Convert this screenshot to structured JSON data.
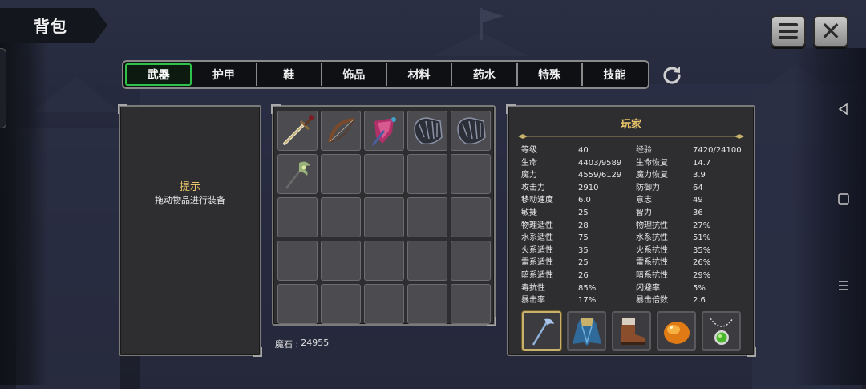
{
  "screen": {
    "title": "背包"
  },
  "top_buttons": {
    "menu_icon": "hamburger-menu-icon",
    "close_icon": "close-x-icon",
    "close_glyph": "✕"
  },
  "tabs": [
    {
      "label": "武器",
      "active": true
    },
    {
      "label": "护甲",
      "active": false
    },
    {
      "label": "鞋",
      "active": false
    },
    {
      "label": "饰品",
      "active": false
    },
    {
      "label": "材料",
      "active": false
    },
    {
      "label": "药水",
      "active": false
    },
    {
      "label": "特殊",
      "active": false
    },
    {
      "label": "技能",
      "active": false
    }
  ],
  "hint": {
    "title": "提示",
    "text": "拖动物品进行装备"
  },
  "inventory": {
    "items": [
      {
        "slot": 1,
        "icon": "sword-icon"
      },
      {
        "slot": 2,
        "icon": "bow-icon"
      },
      {
        "slot": 3,
        "icon": "magic-staff-icon"
      },
      {
        "slot": 4,
        "icon": "gauntlet-icon"
      },
      {
        "slot": 5,
        "icon": "gauntlet-icon"
      },
      {
        "slot": 6,
        "icon": "scepter-icon"
      }
    ],
    "total_slots": 25,
    "currency_label": "魔石 :",
    "currency_value": "24955"
  },
  "stats": {
    "title": "玩家",
    "rows": [
      [
        "等级",
        "40",
        "经验",
        "7420/24100"
      ],
      [
        "生命",
        "4403/9589",
        "生命恢复",
        "14.7"
      ],
      [
        "魔力",
        "4559/6129",
        "魔力恢复",
        "3.9"
      ],
      [
        "攻击力",
        "2910",
        "防御力",
        "64"
      ],
      [
        "移动速度",
        "6.0",
        "意志",
        "49"
      ],
      [
        "敏捷",
        "25",
        "智力",
        "36"
      ],
      [
        "物理适性",
        "28",
        "物理抗性",
        "27%"
      ],
      [
        "水系适性",
        "75",
        "水系抗性",
        "51%"
      ],
      [
        "火系适性",
        "35",
        "火系抗性",
        "35%"
      ],
      [
        "雷系适性",
        "25",
        "雷系抗性",
        "26%"
      ],
      [
        "暗系适性",
        "26",
        "暗系抗性",
        "29%"
      ],
      [
        "毒抗性",
        "85%",
        "闪避率",
        "5%"
      ],
      [
        "暴击率",
        "17%",
        "暴击倍数",
        "2.6"
      ]
    ],
    "equipment": [
      {
        "icon": "staff-weapon-icon",
        "selected": true
      },
      {
        "icon": "cloak-armor-icon",
        "selected": false
      },
      {
        "icon": "boots-icon",
        "selected": false
      },
      {
        "icon": "amber-stone-icon",
        "selected": false
      },
      {
        "icon": "green-amulet-icon",
        "selected": false
      }
    ]
  },
  "colors": {
    "accent_gold": "#e9c46a",
    "active_tab_border": "#2ec24a",
    "panel_bg": "#2e2e31"
  }
}
